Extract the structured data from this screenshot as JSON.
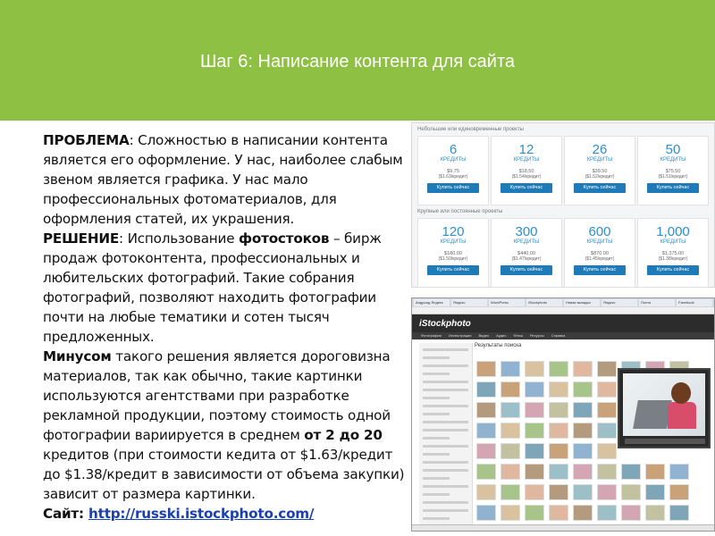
{
  "header": {
    "title": "Шаг 6: Написание контента для сайта",
    "color": "#8dc043"
  },
  "content": {
    "problem_label": "ПРОБЛЕМА",
    "problem_text": ": Сложностью в написании контента является его оформление. У нас, наиболее слабым звеном является графика. У нас мало профессиональных фотоматериалов, для оформления статей, их украшения.",
    "solution_label": "РЕШЕНИЕ",
    "solution_text_1": ": Использование ",
    "solution_bold": "фотостоков",
    "solution_text_2": " – бирж продаж фотоконтента, профессиональных и любительских фотографий. Такие собрания фотографий, позволяют находить фотографии почти на любые тематики и сотен тысяч предложенных.",
    "minus_label": "Минусом",
    "minus_text_1": " такого решения является дороговизна материалов, так как обычно, такие картинки используются агентствами при разработке рекламной продукции, поэтому стоимость одной фотографии вариируется в среднем ",
    "minus_bold": "от  2 до 20",
    "minus_text_2": " кредитов (при стоимости кедита от $1.63/кредит до $1.38/кредит в зависимости от объема закупки) зависит от размера картинки.",
    "site_label": "Сайт",
    "site_colon": ": ",
    "site_link": "http://russki.istockphoto.com/"
  },
  "pricing_screenshot": {
    "section1_label": "Небольшие или единовременные проекты",
    "section2_label": "Крупные или постоянные проекты",
    "buy_label": "Купить сейчас",
    "credits_label": "КРЕДИТЫ",
    "row1": [
      {
        "credits": "6",
        "price": "$9.75",
        "per": "($1.63/кредит)"
      },
      {
        "credits": "12",
        "price": "$18.50",
        "per": "($1.54/кредит)"
      },
      {
        "credits": "26",
        "price": "$39.50",
        "per": "($1.52/кредит)"
      },
      {
        "credits": "50",
        "price": "$75.50",
        "per": "($1.51/кредит)"
      }
    ],
    "row2": [
      {
        "credits": "120",
        "price": "$180.00",
        "per": "($1.50/кредит)"
      },
      {
        "credits": "300",
        "price": "$440.00",
        "per": "($1.47/кредит)"
      },
      {
        "credits": "600",
        "price": "$870.00",
        "per": "($1.45/кредит)"
      },
      {
        "credits": "1,000",
        "price": "$1,375.00",
        "per": "($1.38/кредит)"
      }
    ]
  },
  "istock_screenshot": {
    "logo": "iStockphoto",
    "results_title": "Результаты поиска",
    "nav": [
      "Фотографии",
      "Иллюстрации",
      "Видео",
      "Аудио",
      "Флэш",
      "Ресурсы",
      "Справка"
    ],
    "tabs": [
      "Андроид Яндекс",
      "Яндекс",
      "WordPress",
      "iStockphoto",
      "Новая вкладка",
      "Яндекс",
      "Почта",
      "Facebook"
    ]
  }
}
